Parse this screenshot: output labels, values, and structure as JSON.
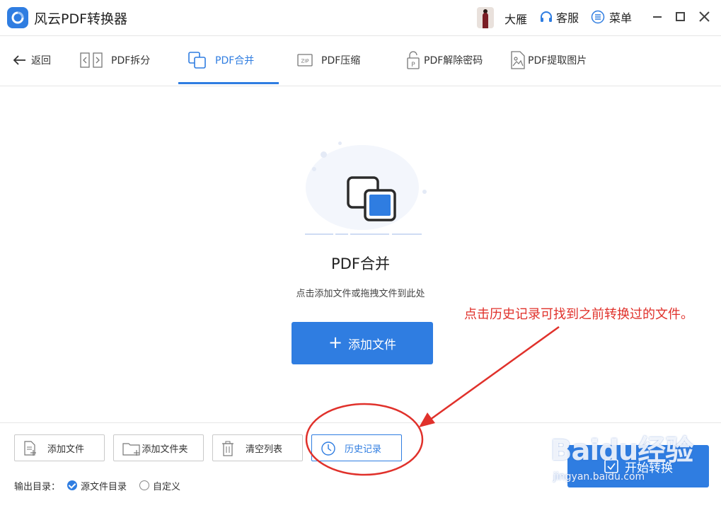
{
  "app": {
    "title": "风云PDF转换器"
  },
  "user": {
    "name": "大雁"
  },
  "header": {
    "service_label": "客服",
    "menu_label": "菜单"
  },
  "nav": {
    "back_label": "返回",
    "tabs": [
      {
        "label": "PDF拆分",
        "icon": "split-icon",
        "active": false
      },
      {
        "label": "PDF合并",
        "icon": "merge-icon",
        "active": true
      },
      {
        "label": "PDF压缩",
        "icon": "zip-icon",
        "active": false
      },
      {
        "label": "PDF解除密码",
        "icon": "unlock-icon",
        "active": false
      },
      {
        "label": "PDF提取图片",
        "icon": "image-icon",
        "active": false
      }
    ]
  },
  "main": {
    "title": "PDF合并",
    "hint": "点击添加文件或拖拽文件到此处",
    "add_file_label": "添加文件"
  },
  "annotation": {
    "text": "点击历史记录可找到之前转换过的文件。"
  },
  "toolbar": {
    "add_file": "添加文件",
    "add_folder": "添加文件夹",
    "clear_list": "清空列表",
    "history": "历史记录",
    "start": "开始转换"
  },
  "output": {
    "label": "输出目录：",
    "options": [
      "源文件目录",
      "自定义"
    ],
    "selected": "源文件目录"
  },
  "watermark": {
    "logo_text": "Baidu经验",
    "url": "jingyan.baidu.com"
  },
  "colors": {
    "accent": "#2f7de1",
    "annotation": "#e0312b"
  }
}
